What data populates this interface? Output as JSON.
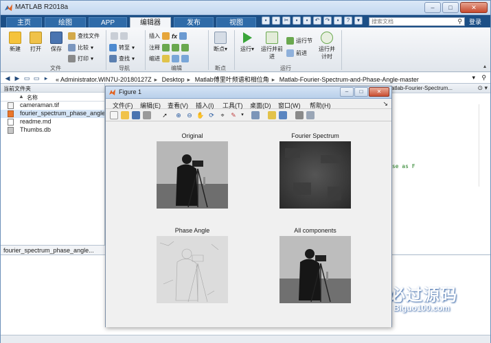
{
  "window": {
    "title": "MATLAB R2018a",
    "buttons": {
      "minimize": "–",
      "maximize": "□",
      "close": "✕"
    }
  },
  "tabs": [
    "主页",
    "绘图",
    "APP",
    "编辑器",
    "发布",
    "视图"
  ],
  "active_tab": "编辑器",
  "search": {
    "placeholder": "搜索文档"
  },
  "login": "登录",
  "ribbon": {
    "file_group": {
      "label": "文件",
      "new": "新建",
      "open": "打开",
      "save": "保存",
      "find_files": "查找文件",
      "compare": "比较",
      "print": "打印"
    },
    "nav_group": {
      "label": "导航",
      "goto": "转至",
      "find": "查找"
    },
    "edit_group": {
      "label": "编辑",
      "insert": "插入",
      "comment": "注释",
      "indent": "缩进"
    },
    "breakpoint_group": {
      "label": "断点",
      "breakpoints": "断点"
    },
    "run_group": {
      "label": "运行",
      "run": "运行",
      "run_advance": "运行并前进",
      "run_section": "运行节",
      "advance": "前进",
      "run_time": "运行并计时"
    }
  },
  "address": {
    "prefix": "«",
    "crumbs": [
      "Administrator.WIN7U-20180127Z",
      "Desktop",
      "Matlab傅里叶频谱和相位角",
      "Matlab-Fourier-Spectrum-and-Phase-Angle-master"
    ]
  },
  "current_folder": {
    "title": "当前文件夹",
    "column": "名称",
    "files": [
      "cameraman.tif",
      "fourier_spectrum_phase_angle.m",
      "readme.md",
      "Thumbs.db"
    ],
    "selected_index": 1,
    "detail": "fourier_spectrum_phase_angle..."
  },
  "editor": {
    "tab": "atlab-Fourier-Spectrum...",
    "code_fragment": "ase as F"
  },
  "figure": {
    "title": "Figure 1",
    "menu": [
      "文件(F)",
      "编辑(E)",
      "查看(V)",
      "插入(I)",
      "工具(T)",
      "桌面(D)",
      "窗口(W)",
      "帮助(H)"
    ],
    "subplots": [
      "Original",
      "Fourier Spectrum",
      "Phase Angle",
      "All components"
    ]
  },
  "watermark": {
    "cn": "必过源码",
    "en": "Biguo100.com"
  },
  "colors": {
    "tab_bar": "#1c4f86",
    "accent": "#2f6ba8"
  }
}
